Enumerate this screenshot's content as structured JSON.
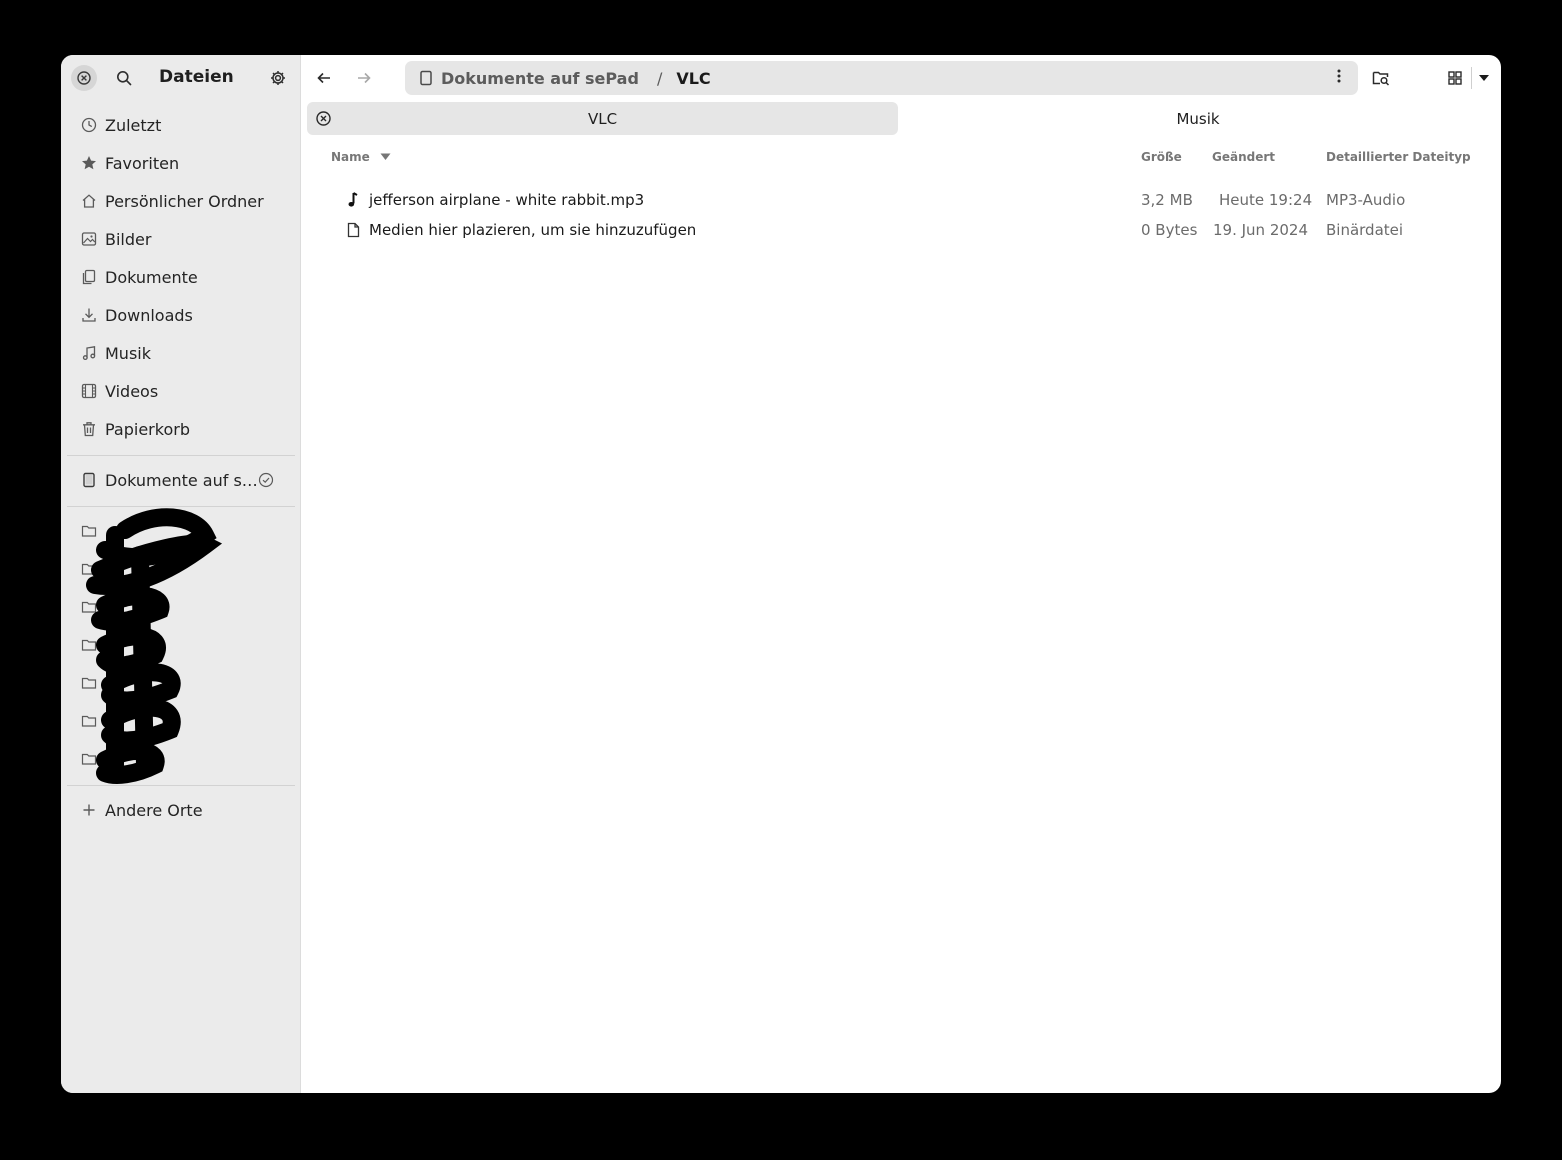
{
  "sidebar": {
    "title": "Dateien",
    "items": [
      {
        "label": "Zuletzt",
        "icon": "clock-icon"
      },
      {
        "label": "Favoriten",
        "icon": "star-icon"
      },
      {
        "label": "Persönlicher Ordner",
        "icon": "home-icon"
      },
      {
        "label": "Bilder",
        "icon": "image-icon"
      },
      {
        "label": "Dokumente",
        "icon": "documents-icon"
      },
      {
        "label": "Downloads",
        "icon": "download-icon"
      },
      {
        "label": "Musik",
        "icon": "music-icon"
      },
      {
        "label": "Videos",
        "icon": "film-icon"
      },
      {
        "label": "Papierkorb",
        "icon": "trash-icon"
      }
    ],
    "device": {
      "label": "Dokumente auf s…",
      "icon": "tablet-icon"
    },
    "other_places": {
      "label": "Andere Orte",
      "icon": "plus-icon"
    }
  },
  "pathbar": {
    "location": "Dokumente auf sePad",
    "separator": "/",
    "current": "VLC"
  },
  "tabs": [
    {
      "label": "VLC",
      "active": true
    },
    {
      "label": "Musik",
      "active": false
    }
  ],
  "columns": {
    "name": "Name",
    "size": "Größe",
    "modified": "Geändert",
    "type": "Detaillierter Dateityp"
  },
  "files": [
    {
      "name": "jefferson airplane - white rabbit.mp3",
      "size": "3,2 MB",
      "modified": "Heute 19:24",
      "type": "MP3-Audio",
      "icon": "music-note-icon"
    },
    {
      "name": "Medien hier plazieren, um sie hinzuzufügen",
      "size": "0 Bytes",
      "modified": "19. Jun 2024",
      "type": "Binärdatei",
      "icon": "file-icon"
    }
  ]
}
